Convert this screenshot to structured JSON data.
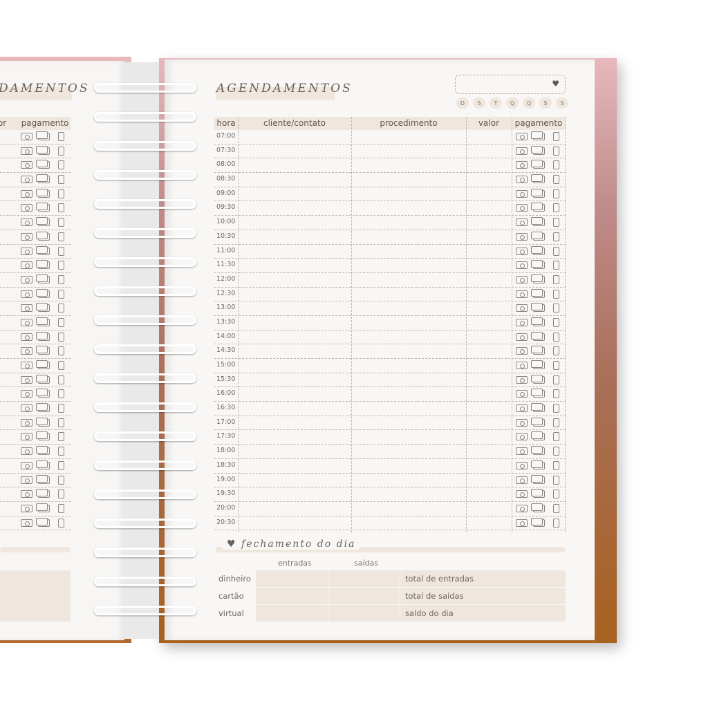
{
  "right_page": {
    "title": "AGENDAMENTOS",
    "date_icon": "heart-icon",
    "weekdays": [
      "D",
      "S",
      "T",
      "Q",
      "Q",
      "S",
      "S"
    ],
    "columns": [
      "hora",
      "cliente/contato",
      "procedimento",
      "valor",
      "pagamento"
    ],
    "hours": [
      "07:00",
      "07:30",
      "08:00",
      "08:30",
      "09:00",
      "09:30",
      "10:00",
      "10:30",
      "11:00",
      "11:30",
      "12:00",
      "12:30",
      "13:00",
      "13:30",
      "14:00",
      "14:30",
      "15:00",
      "15:30",
      "16:00",
      "16:30",
      "17:00",
      "17:30",
      "18:00",
      "18:30",
      "19:00",
      "19:30",
      "20:00",
      "20:30"
    ],
    "payment_icons": [
      "cash-icon",
      "card-icon",
      "phone-icon"
    ],
    "closing": {
      "title": "fechamento do dia",
      "col_entradas": "entradas",
      "col_saidas": "saídas",
      "rows": [
        "dinheiro",
        "cartão",
        "virtual"
      ],
      "totals": [
        "total de entradas",
        "total de saídas",
        "saldo do dia"
      ]
    }
  },
  "left_page": {
    "title_fragment": "DAMENTOS",
    "col_fragment_valor": "or",
    "col_pagamento": "pagamento"
  },
  "colors": {
    "cover_top": "#e7b8bc",
    "cover_bottom": "#a8611f",
    "accent_beige": "#efe6dd"
  }
}
